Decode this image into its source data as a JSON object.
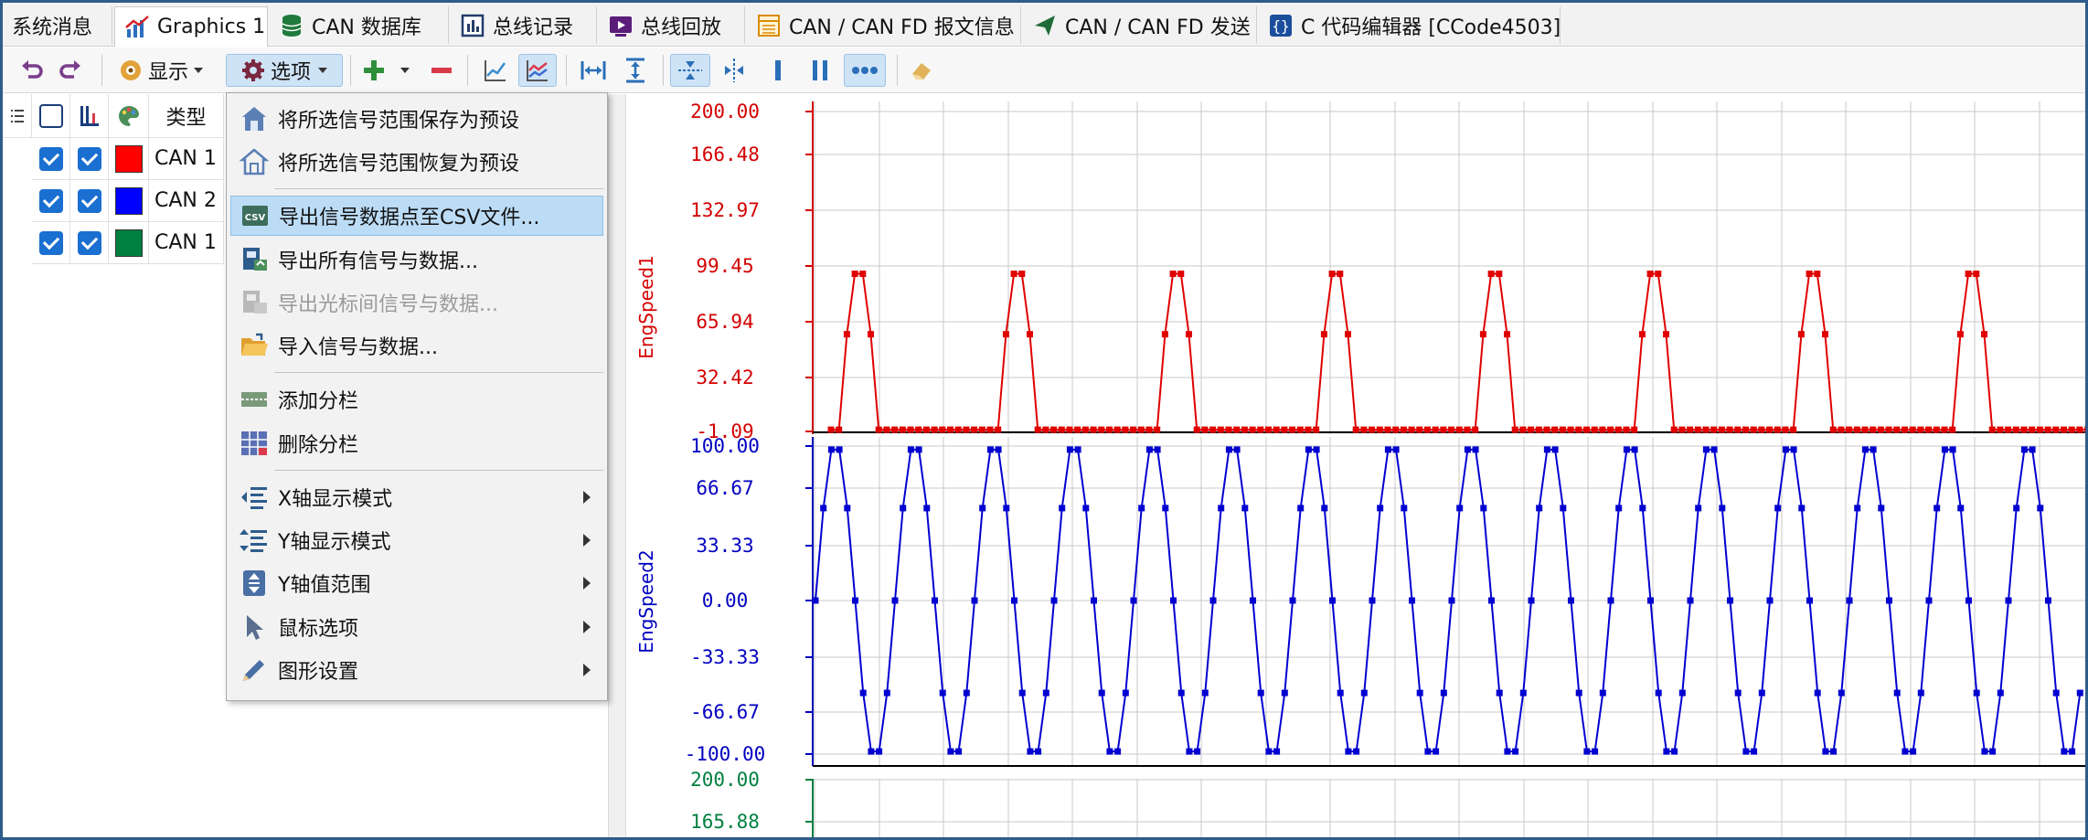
{
  "tabs": [
    {
      "label": "系统消息",
      "icon": "none"
    },
    {
      "label": "Graphics 1",
      "icon": "chart-icon",
      "active": true
    },
    {
      "label": "CAN 数据库",
      "icon": "database-icon"
    },
    {
      "label": "总线记录",
      "icon": "bus-log-icon"
    },
    {
      "label": "总线回放",
      "icon": "replay-icon"
    },
    {
      "label": "CAN / CAN FD 报文信息",
      "icon": "message-table-icon"
    },
    {
      "label": "CAN / CAN FD 发送",
      "icon": "send-icon"
    },
    {
      "label": "C 代码编辑器 [CCode4503]",
      "icon": "code-braces-icon"
    }
  ],
  "toolbar": {
    "display_label": "显示",
    "options_label": "选项"
  },
  "signal_list": {
    "header_type": "类型",
    "rows": [
      {
        "name": "CAN 1",
        "color": "#ff0000"
      },
      {
        "name": "CAN 2",
        "color": "#0000ff"
      },
      {
        "name": "CAN 1",
        "color": "#008040"
      }
    ]
  },
  "menu": {
    "items": [
      {
        "label": "将所选信号范围保存为预设",
        "icon": "home-save-icon"
      },
      {
        "label": "将所选信号范围恢复为预设",
        "icon": "home-restore-icon"
      },
      {
        "label": "导出信号数据点至CSV文件...",
        "icon": "csv-icon",
        "highlighted": true
      },
      {
        "label": "导出所有信号与数据...",
        "icon": "export-all-icon"
      },
      {
        "label": "导出光标间信号与数据...",
        "icon": "export-cursor-icon",
        "disabled": true
      },
      {
        "label": "导入信号与数据...",
        "icon": "folder-open-icon"
      },
      {
        "label": "添加分栏",
        "icon": "add-pane-icon"
      },
      {
        "label": "删除分栏",
        "icon": "delete-pane-icon"
      },
      {
        "label": "X轴显示模式",
        "icon": "x-axis-mode-icon",
        "submenu": true
      },
      {
        "label": "Y轴显示模式",
        "icon": "y-axis-mode-icon",
        "submenu": true
      },
      {
        "label": "Y轴值范围",
        "icon": "y-range-icon",
        "submenu": true
      },
      {
        "label": "鼠标选项",
        "icon": "cursor-icon",
        "submenu": true
      },
      {
        "label": "图形设置",
        "icon": "pencil-icon",
        "submenu": true
      }
    ]
  },
  "chart_data": [
    {
      "type": "line",
      "ylabel": "EngSpeed1",
      "color": "#e00000",
      "ylim": [
        -1.09,
        200.0
      ],
      "yticks": [
        "200.00",
        "166.48",
        "132.97",
        "99.45",
        "65.94",
        "32.42",
        "-1.09"
      ],
      "period_samples": 20,
      "pattern": [
        0,
        0,
        60,
        98,
        98,
        60,
        0,
        0,
        0,
        0,
        0,
        0,
        0,
        0,
        0,
        0,
        0,
        0,
        0,
        0
      ]
    },
    {
      "type": "line",
      "ylabel": "EngSpeed2",
      "color": "#0000d0",
      "ylim": [
        -100.0,
        100.0
      ],
      "yticks": [
        "100.00",
        "66.67",
        "33.33",
        "0.00",
        "-33.33",
        "-66.67",
        "-100.00"
      ],
      "period_samples": 20,
      "pattern": [
        0,
        60,
        98,
        98,
        60,
        0,
        -60,
        -98,
        -98,
        -60,
        0,
        60,
        98,
        98,
        60,
        0,
        -60,
        -98,
        -98,
        -60
      ]
    },
    {
      "type": "line",
      "ylabel": "",
      "color": "#008040",
      "yticks": [
        "200.00",
        "165.88"
      ]
    }
  ]
}
